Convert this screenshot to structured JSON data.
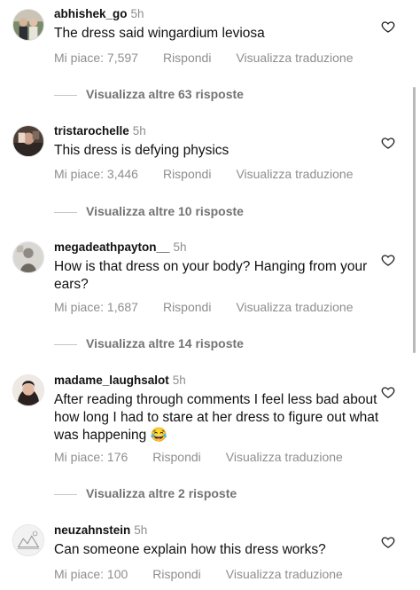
{
  "comments": [
    {
      "username": "abhishek_go",
      "time": "5h",
      "text": "The dress said wingardium leviosa",
      "likes": "Mi piace: 7,597",
      "reply": "Rispondi",
      "translate": "Visualizza traduzione",
      "more_replies": "Visualizza altre 63 risposte"
    },
    {
      "username": "tristarochelle",
      "time": "5h",
      "text": "This dress is defying physics",
      "likes": "Mi piace: 3,446",
      "reply": "Rispondi",
      "translate": "Visualizza traduzione",
      "more_replies": "Visualizza altre 10 risposte"
    },
    {
      "username": "megadeathpayton__",
      "time": "5h",
      "text": "How is that dress on your body? Hanging from your ears?",
      "likes": "Mi piace: 1,687",
      "reply": "Rispondi",
      "translate": "Visualizza traduzione",
      "more_replies": "Visualizza altre 14 risposte"
    },
    {
      "username": "madame_laughsalot",
      "time": "5h",
      "text": "After reading through comments I feel less bad about how long I had to stare at her dress to figure out what was happening 😂",
      "likes": "Mi piace: 176",
      "reply": "Rispondi",
      "translate": "Visualizza traduzione",
      "more_replies": "Visualizza altre 2 risposte"
    },
    {
      "username": "neuzahnstein",
      "time": "5h",
      "text": "Can someone explain how this dress works?",
      "likes": "Mi piace: 100",
      "reply": "Rispondi",
      "translate": "Visualizza traduzione"
    }
  ],
  "icons": {
    "like": "heart-outline-icon",
    "avatar": "user-avatar"
  },
  "colors": {
    "text": "#111111",
    "secondary": "#8e8e8e",
    "divider": "#c7c7c7"
  }
}
